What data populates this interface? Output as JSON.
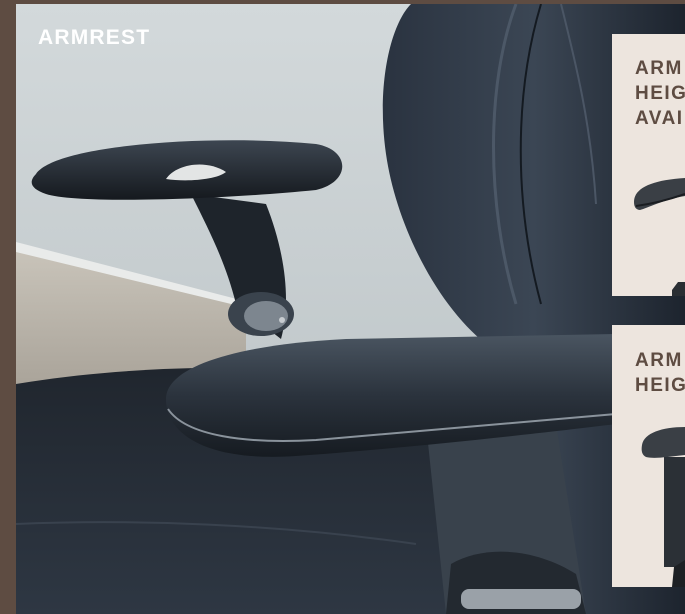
{
  "section": {
    "title": "ARMREST"
  },
  "cards": [
    {
      "lines": [
        "ARM",
        "HEIG",
        "AVAI"
      ]
    },
    {
      "lines": [
        "ARM",
        "HEIG"
      ]
    }
  ],
  "colors": {
    "frame": "#5e4c42",
    "card_background": "#ede5de",
    "card_text": "#5e4c42",
    "title_text": "#ffffff"
  }
}
